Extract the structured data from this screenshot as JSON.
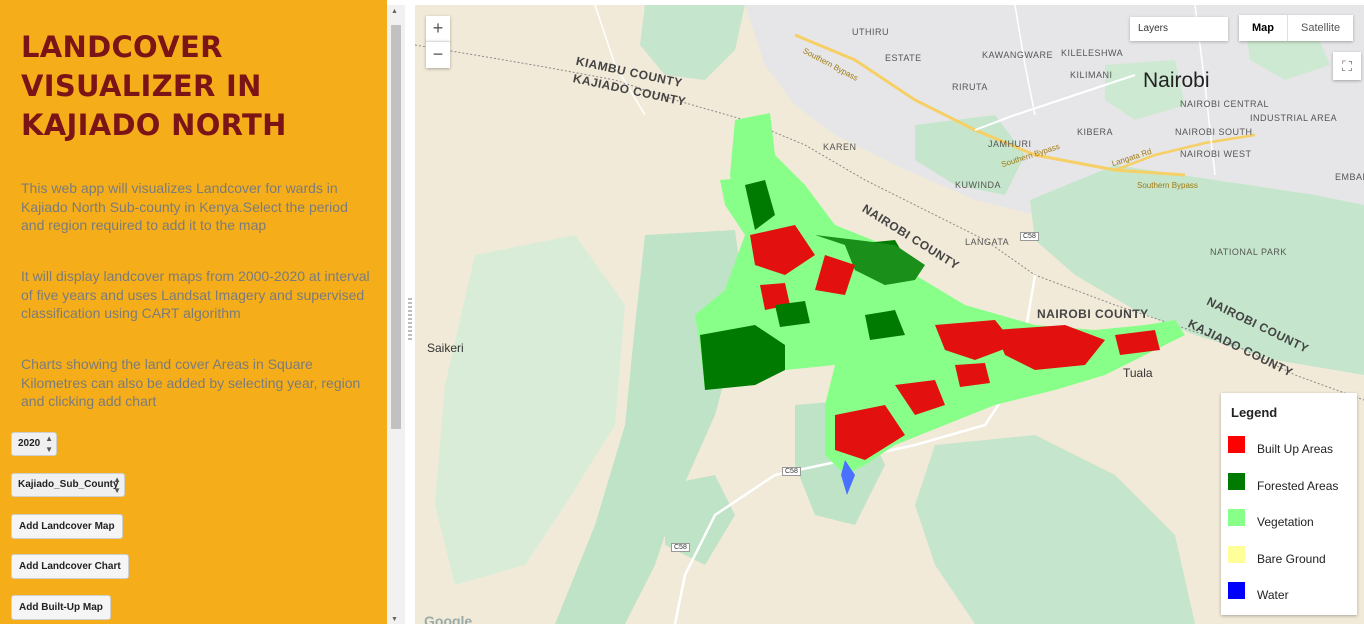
{
  "sidebar": {
    "title": "LANDCOVER VISUALIZER IN KAJIADO NORTH",
    "description_1": "This web app will visualizes Landcover for wards in Kajiado North Sub-county in Kenya.Select the period and region required to add it to the map",
    "description_2": "It will display landcover maps from 2000-2020 at interval of five years and uses Landsat Imagery and supervised classification using CART algorithm",
    "description_3": "Charts showing the land cover Areas in Square Kilometres can also be added by selecting year, region and clicking add chart",
    "year_select": {
      "value": "2020"
    },
    "region_select": {
      "value": "Kajiado_Sub_County"
    },
    "buttons": {
      "add_map": "Add Landcover Map",
      "add_chart": "Add Landcover Chart",
      "add_builtup": "Add Built-Up Map"
    },
    "colors": {
      "background": "#f5ae19",
      "title": "#7b1416",
      "text": "#7b7b7b"
    }
  },
  "map": {
    "zoom_in": "+",
    "zoom_out": "−",
    "layers_label": "Layers",
    "map_types": {
      "map": "Map",
      "satellite": "Satellite",
      "selected": "Map"
    },
    "fullscreen_icon": "fullscreen-icon",
    "attribution_logo": "Google",
    "labels": {
      "nairobi": "Nairobi",
      "kiambu_county": "KIAMBU COUNTY",
      "kajiado_county_top": "KAJIADO COUNTY",
      "nairobi_county_1": "NAIROBI COUNTY",
      "nairobi_county_2": "NAIROBI COUNTY",
      "nairobi_county_3": "NAIROBI COUNTY",
      "kajiado_county_right": "KAJIADO COUNTY",
      "saikeri": "Saikeri",
      "tuala": "Tuala",
      "uthiru": "UTHIRU",
      "estate": "ESTATE",
      "kawangware": "KAWANGWARE",
      "kileleshwa": "KILELESHWA",
      "kilimani": "KILIMANI",
      "nairobi_central": "NAIROBI CENTRAL",
      "riruta": "RIRUTA",
      "karen": "KAREN",
      "jamhuri": "JAMHURI",
      "kibera": "KIBERA",
      "nairobi_south": "NAIROBI SOUTH",
      "industrial_area": "INDUSTRIAL AREA",
      "nairobi_west": "NAIROBI WEST",
      "kuwinda": "KUWINDA",
      "langata": "LANGATA",
      "national_park": "NATIONAL PARK",
      "southern_bypass_1": "Southern Bypass",
      "southern_bypass_2": "Southern Bypass",
      "southern_bypass_3": "Southern Bypass",
      "langata_rd": "Langata Rd",
      "embakasi": "EMBAKASI",
      "c58_1": "C58",
      "c58_2": "C58",
      "c58_3": "C58"
    }
  },
  "legend": {
    "title": "Legend",
    "items": [
      {
        "label": "Built Up Areas",
        "color": "#ff0000"
      },
      {
        "label": "Forested Areas",
        "color": "#007a00"
      },
      {
        "label": "Vegetation",
        "color": "#88ff88"
      },
      {
        "label": "Bare Ground",
        "color": "#ffff99"
      },
      {
        "label": "Water",
        "color": "#0000ff"
      }
    ]
  }
}
